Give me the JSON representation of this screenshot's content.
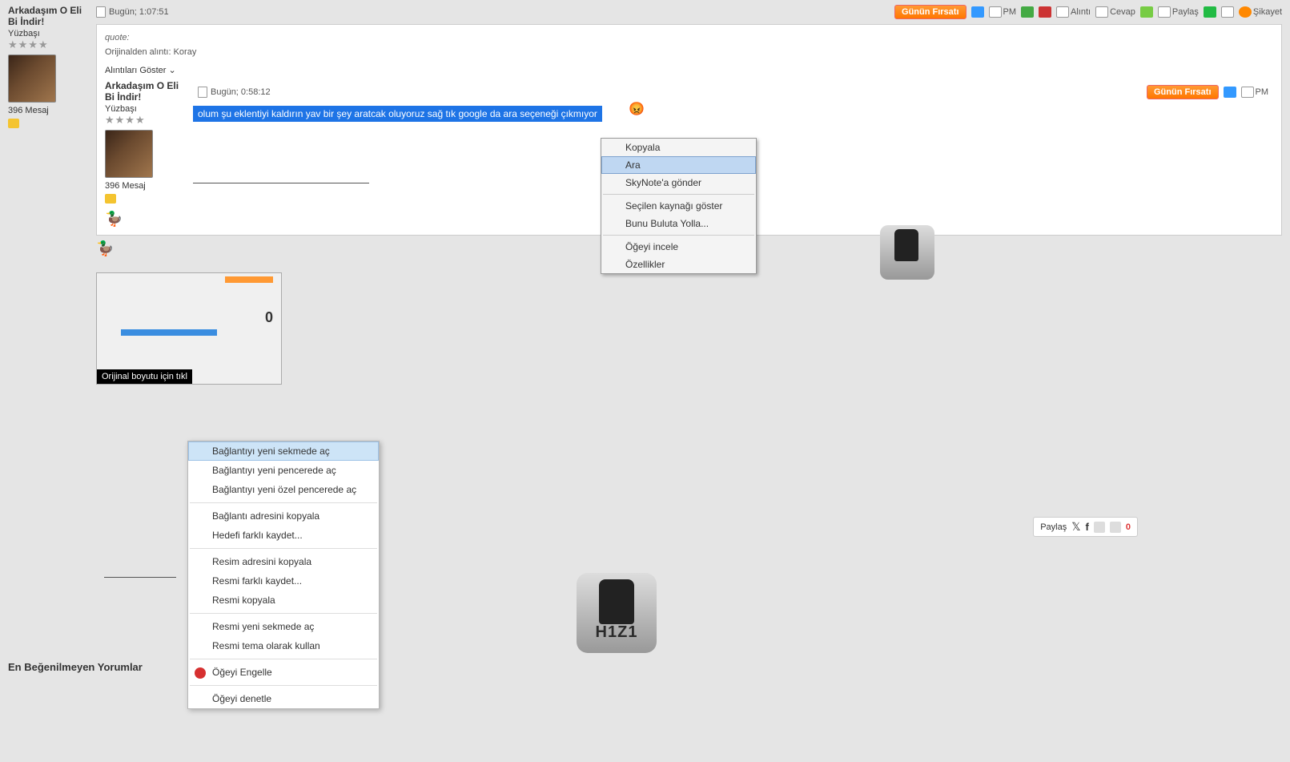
{
  "user": {
    "name": "Arkadaşım O Eli Bi İndir!",
    "rank": "Yüzbaşı",
    "messages": "396 Mesaj"
  },
  "post": {
    "timestamp": "Bugün; 1:07:51",
    "quote_label": "quote:",
    "quote_origin": "Orijinalden alıntı: Koray",
    "quote_toggle": "Alıntıları Göster"
  },
  "nested": {
    "timestamp": "Bugün; 0:58:12",
    "text": "olum şu eklentiyi kaldırın yav bir şey aratcak oluyoruz sağ tık google da ara seçeneği çıkmıyor"
  },
  "toolbar": {
    "gunun_firsati": "Günün Fırsatı",
    "pm": "PM",
    "alinti": "Alıntı",
    "cevap": "Cevap",
    "paylas": "Paylaş",
    "sikayet": "Şikayet"
  },
  "ctx1": {
    "copy": "Kopyala",
    "search": "Ara",
    "skynote": "SkyNote'a gönder",
    "viewsource": "Seçilen kaynağı göster",
    "buluta": "Bunu Buluta Yolla...",
    "inspect": "Öğeyi incele",
    "props": "Özellikler"
  },
  "ctx2": {
    "newtab": "Bağlantıyı yeni sekmede aç",
    "newwin": "Bağlantıyı yeni pencerede aç",
    "newpriv": "Bağlantıyı yeni özel pencerede aç",
    "copylink": "Bağlantı adresini kopyala",
    "savetarget": "Hedefi farklı kaydet...",
    "copyimgaddr": "Resim adresini kopyala",
    "saveimg": "Resmi farklı kaydet...",
    "copyimg": "Resmi kopyala",
    "imgtab": "Resmi yeni sekmede aç",
    "imgtheme": "Resmi tema olarak kullan",
    "block": "Öğeyi Engelle",
    "inspect": "Öğeyi denetle"
  },
  "thumb": {
    "caption": "Orijinal boyutu için tıkl",
    "zero": "0"
  },
  "sharebar": {
    "label": "Paylaş",
    "count": "0"
  },
  "sig": {
    "h1z1": "H1Z1"
  },
  "bottom": {
    "label": "En Beğenilmeyen Yorumlar"
  }
}
